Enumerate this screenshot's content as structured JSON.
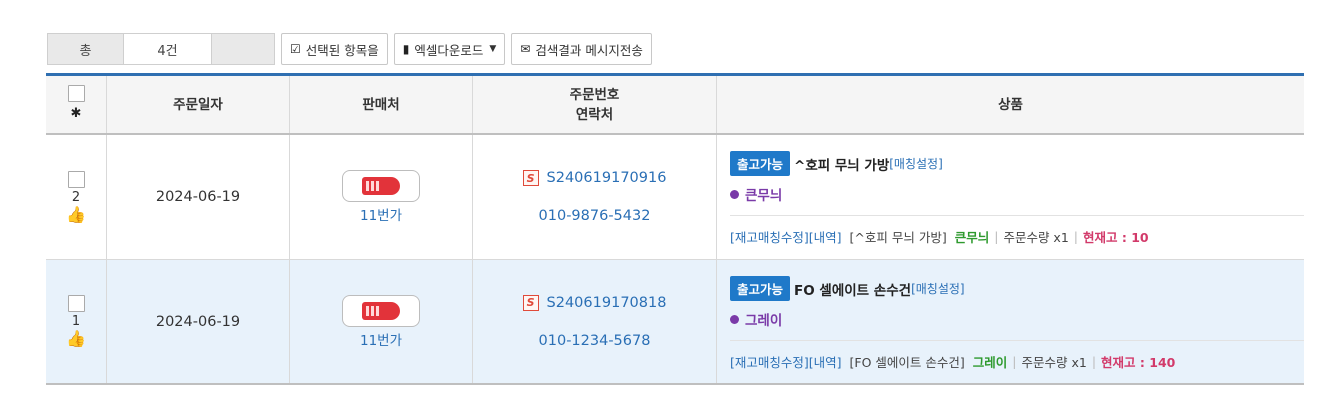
{
  "summary": {
    "total_label": "총",
    "total_value": "4건"
  },
  "toolbar": {
    "selected_label": "선택된 항목을",
    "excel_label": "엑셀다운로드",
    "message_label": "검색결과 메시지전송"
  },
  "columns": {
    "date": "주문일자",
    "seller": "판매처",
    "order_no": "주문번호",
    "contact": "연락처",
    "product": "상품"
  },
  "rows": [
    {
      "index": "2",
      "date": "2024-06-19",
      "seller": "11번가",
      "order_no": "S240619170916",
      "tel": "010-9876-5432",
      "status": "출고가능",
      "product_name": "^호피 무늬 가방",
      "matching_link": "[매칭설정]",
      "option": "큰무늬",
      "stock_edit_link": "[재고매칭수정]",
      "history_link": "[내역]",
      "bracket_name": "[^호피 무늬 가방]",
      "option_short": "큰무늬",
      "qty_text": "주문수량 x1",
      "stock_text": "현재고 : 10"
    },
    {
      "index": "1",
      "date": "2024-06-19",
      "seller": "11번가",
      "order_no": "S240619170818",
      "tel": "010-1234-5678",
      "status": "출고가능",
      "product_name": "FO 셀에이트 손수건",
      "matching_link": "[매칭설정]",
      "option": "그레이",
      "stock_edit_link": "[재고매칭수정]",
      "history_link": "[내역]",
      "bracket_name": "[FO 셀에이트 손수건]",
      "option_short": "그레이",
      "qty_text": "주문수량 x1",
      "stock_text": "현재고 : 140"
    }
  ],
  "icons": {
    "checkbox_square": "check-square-icon",
    "file": "file-icon",
    "envelope": "envelope-icon",
    "gear": "gear-icon",
    "thumb": "thumbs-up-icon",
    "seller_badge": "s-badge-icon"
  },
  "colors": {
    "accent": "#2f6fb1",
    "status_badge": "#1f79c9",
    "alt_row": "#e8f2fb"
  }
}
